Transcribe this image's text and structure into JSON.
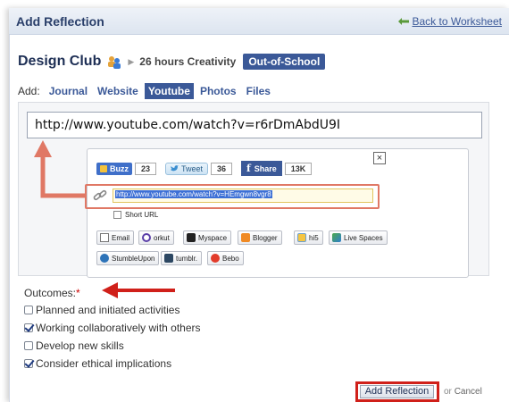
{
  "header": {
    "title": "Add Reflection",
    "back_link": "Back to Worksheet"
  },
  "breadcrumb": {
    "club": "Design Club",
    "activity": "26 hours Creativity",
    "badge": "Out-of-School"
  },
  "add_menu": {
    "label": "Add:",
    "tabs": [
      {
        "label": "Journal",
        "active": false
      },
      {
        "label": "Website",
        "active": false
      },
      {
        "label": "Youtube",
        "active": true
      },
      {
        "label": "Photos",
        "active": false
      },
      {
        "label": "Files",
        "active": false
      }
    ]
  },
  "url_input": {
    "value": "http://www.youtube.com/watch?v=r6rDmAbdU9I"
  },
  "share_panel": {
    "close": "×",
    "buzz": {
      "label": "Buzz",
      "count": "23"
    },
    "tweet": {
      "label": "Tweet",
      "count": "36"
    },
    "facebook": {
      "label": "Share",
      "count": "13K"
    },
    "link_value": "http://www.youtube.com/watch?v=HEmgwn8vgr8",
    "short_url": "Short URL",
    "services": [
      "Email",
      "orkut",
      "Myspace",
      "Blogger",
      "hi5",
      "Live Spaces",
      "StumbleUpon",
      "tumblr.",
      "Bebo"
    ]
  },
  "outcomes": {
    "label": "Outcomes:",
    "required_mark": "*",
    "items": [
      {
        "label": "Planned and initiated activities",
        "checked": false
      },
      {
        "label": "Working collaboratively with others",
        "checked": true
      },
      {
        "label": "Develop new skills",
        "checked": false
      },
      {
        "label": "Consider ethical implications",
        "checked": true
      }
    ]
  },
  "footer": {
    "submit": "Add Reflection",
    "or": "or",
    "cancel": "Cancel"
  },
  "colors": {
    "brand": "#3b5998",
    "annotation_red": "#d0201a",
    "annotation_salmon": "#e07865"
  }
}
